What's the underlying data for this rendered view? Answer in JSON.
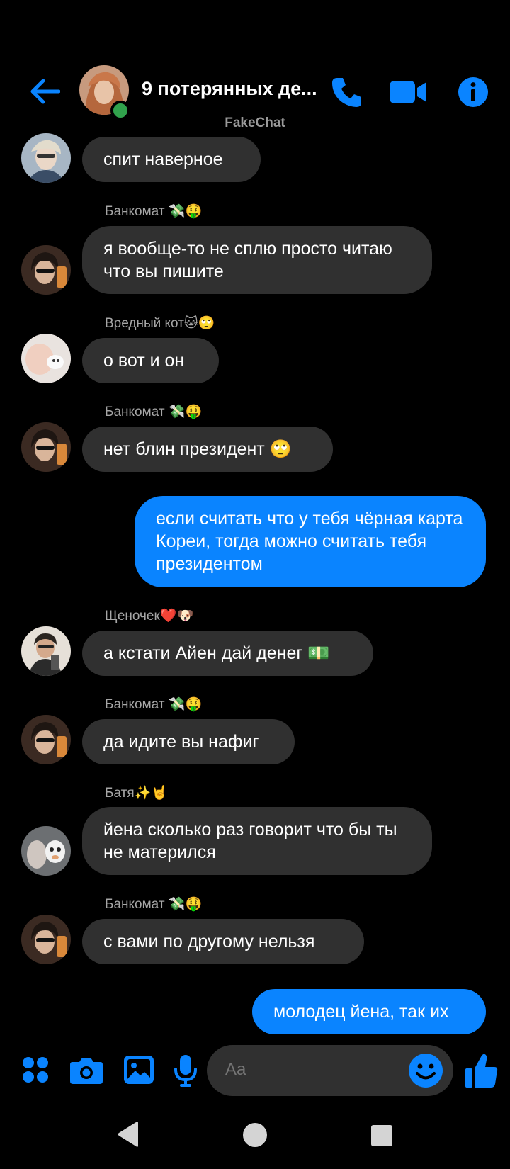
{
  "header": {
    "back_icon": "arrow-left-icon",
    "title": "9 потерянных де...",
    "call_icon": "phone-icon",
    "video_icon": "video-camera-icon",
    "info_icon": "info-icon",
    "online": true
  },
  "app_label": "FakeChat",
  "accent": "#0a84ff",
  "messages": [
    {
      "sender": "",
      "text": "спит наверное",
      "dir": "in"
    },
    {
      "sender": "Банкомат 💸🤑",
      "text": "я вообще-то не сплю просто читаю что вы пишите",
      "dir": "in"
    },
    {
      "sender": "Вредный кот🐱🙄",
      "text": "о вот и он",
      "dir": "in"
    },
    {
      "sender": "Банкомат 💸🤑",
      "text": "нет блин президент 🙄",
      "dir": "in"
    },
    {
      "sender": "",
      "text": "если считать что у тебя чёрная карта Кореи, тогда можно считать тебя президентом",
      "dir": "out"
    },
    {
      "sender": "Щеночек❤️🐶",
      "text": "а кстати Айен дай денег 💵",
      "dir": "in"
    },
    {
      "sender": "Банкомат 💸🤑",
      "text": "да идите вы нафиг",
      "dir": "in"
    },
    {
      "sender": "Батя✨🤘",
      "text": "йена сколько раз говорит что бы ты не матерился",
      "dir": "in"
    },
    {
      "sender": "Банкомат 💸🤑",
      "text": "с вами по другому нельзя",
      "dir": "in"
    },
    {
      "sender": "",
      "text": "молодец йена, так их",
      "dir": "out"
    }
  ],
  "composer": {
    "placeholder": "Aa",
    "apps_icon": "apps-grid-icon",
    "camera_icon": "camera-icon",
    "gallery_icon": "image-icon",
    "mic_icon": "microphone-icon",
    "emoji_icon": "smiley-icon",
    "like_icon": "thumbs-up-icon"
  },
  "navbar": {
    "back_icon": "nav-back-triangle-icon",
    "home_icon": "nav-home-circle-icon",
    "recents_icon": "nav-recents-square-icon"
  }
}
